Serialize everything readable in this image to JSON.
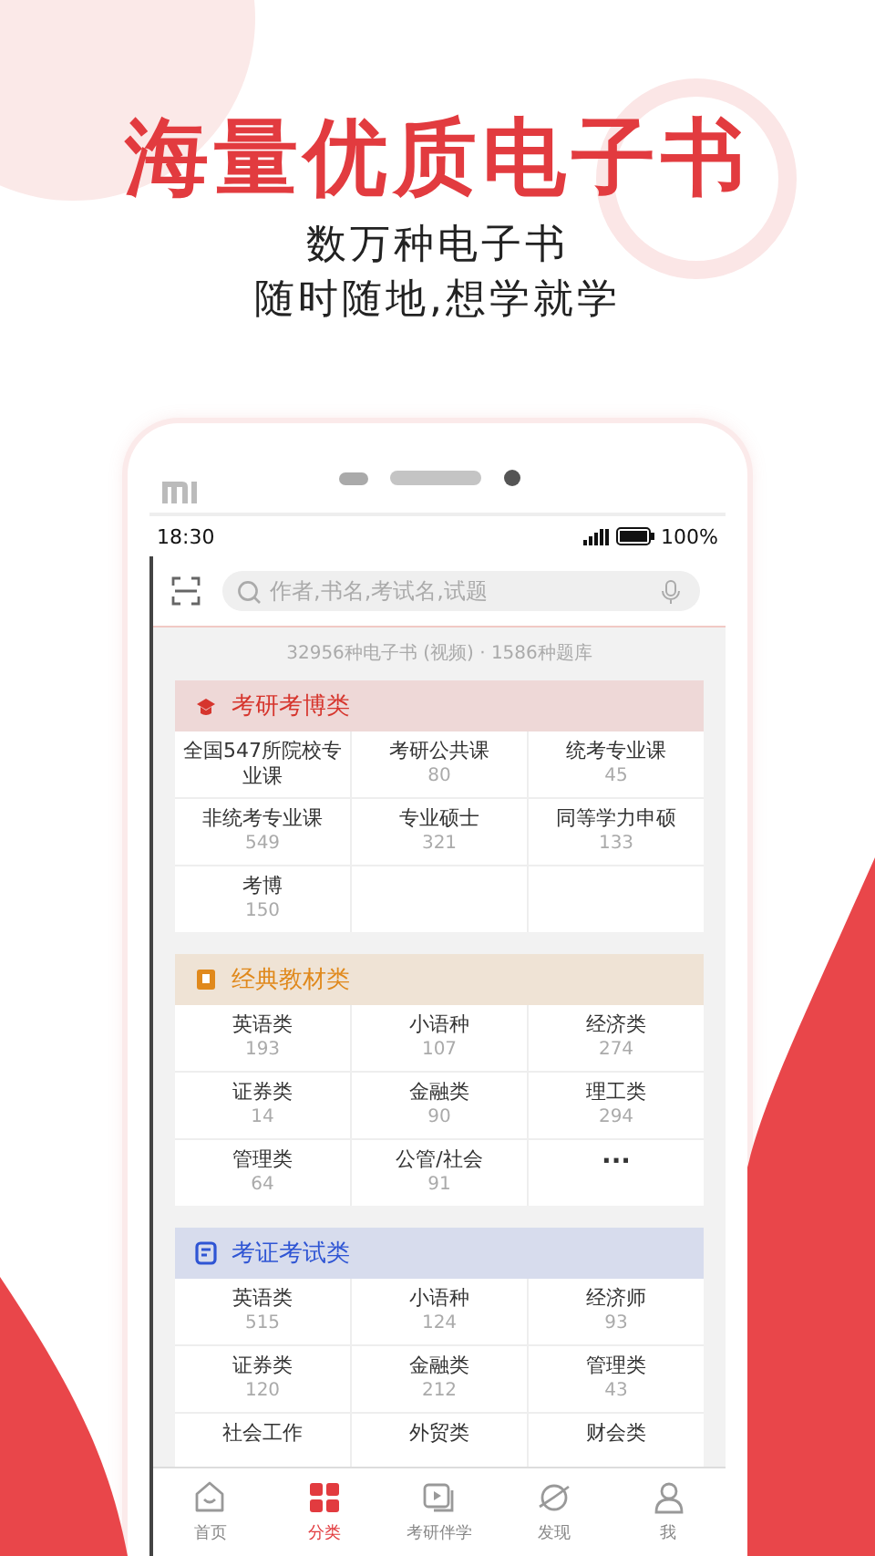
{
  "promo": {
    "headline": "海量优质电子书",
    "taglines": [
      "数万种电子书",
      "随时随地,想学就学"
    ]
  },
  "status_bar": {
    "time": "18:30",
    "battery": "100%"
  },
  "search": {
    "placeholder": "作者,书名,考试名,试题"
  },
  "summary": "32956种电子书 (视频) · 1586种题库",
  "sections": [
    {
      "title": "考研考博类",
      "color": "#d6352d",
      "items": [
        {
          "kind": "category",
          "name": "全国547所院校专业课"
        },
        {
          "kind": "category",
          "name": "考研公共课",
          "count": "80"
        },
        {
          "kind": "category",
          "name": "统考专业课",
          "count": "45"
        },
        {
          "kind": "category",
          "name": "非统考专业课",
          "count": "549"
        },
        {
          "kind": "category",
          "name": "专业硕士",
          "count": "321"
        },
        {
          "kind": "category",
          "name": "同等学力申硕",
          "count": "133"
        },
        {
          "kind": "category",
          "name": "考博",
          "count": "150"
        }
      ]
    },
    {
      "title": "经典教材类",
      "color": "#e0891c",
      "items": [
        {
          "kind": "category",
          "name": "英语类",
          "count": "193"
        },
        {
          "kind": "category",
          "name": "小语种",
          "count": "107"
        },
        {
          "kind": "category",
          "name": "经济类",
          "count": "274"
        },
        {
          "kind": "category",
          "name": "证券类",
          "count": "14"
        },
        {
          "kind": "category",
          "name": "金融类",
          "count": "90"
        },
        {
          "kind": "category",
          "name": "理工类",
          "count": "294"
        },
        {
          "kind": "category",
          "name": "管理类",
          "count": "64"
        },
        {
          "kind": "category",
          "name": "公管/社会",
          "count": "91"
        },
        {
          "kind": "more",
          "name": "···"
        }
      ]
    },
    {
      "title": "考证考试类",
      "color": "#2f55d4",
      "items": [
        {
          "kind": "category",
          "name": "英语类",
          "count": "515"
        },
        {
          "kind": "category",
          "name": "小语种",
          "count": "124"
        },
        {
          "kind": "category",
          "name": "经济师",
          "count": "93"
        },
        {
          "kind": "category",
          "name": "证券类",
          "count": "120"
        },
        {
          "kind": "category",
          "name": "金融类",
          "count": "212"
        },
        {
          "kind": "category",
          "name": "管理类",
          "count": "43"
        },
        {
          "kind": "category",
          "name": "社会工作"
        },
        {
          "kind": "category",
          "name": "外贸类"
        },
        {
          "kind": "category",
          "name": "财会类"
        }
      ]
    }
  ],
  "tabs": [
    {
      "label": "首页",
      "selected": false
    },
    {
      "label": "分类",
      "selected": true
    },
    {
      "label": "考研伴学",
      "selected": false
    },
    {
      "label": "发现",
      "selected": false
    },
    {
      "label": "我",
      "selected": false
    }
  ]
}
